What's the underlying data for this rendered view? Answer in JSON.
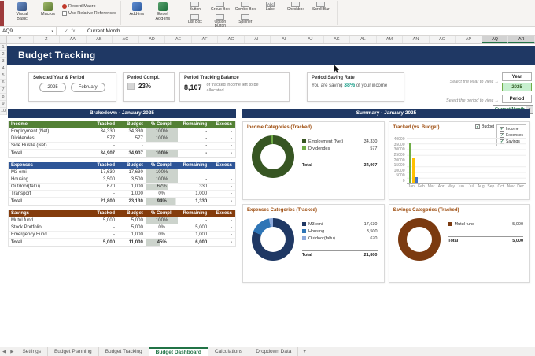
{
  "theme": {
    "navy": "#1F3864",
    "excel_green": "#217346",
    "card_title": "#9C4A0B",
    "teal": "#21A18C",
    "accent_strip": "#9E3B3B",
    "pct_fill_color": "#CCD3CC"
  },
  "ribbon": {
    "visual_basic": "Visual Basic",
    "macros": "Macros",
    "record_macro": "Record Macro",
    "use_relative_references": "Use Relative References",
    "add_ins": "Add-ins",
    "excel_add_ins": "Excel Add-ins",
    "controls": [
      {
        "label": "Button",
        "icon": ""
      },
      {
        "label": "Group Box",
        "icon": ""
      },
      {
        "label": "Combo Box",
        "icon": ""
      },
      {
        "label": "Label",
        "icon": "Abc"
      },
      {
        "label": "Checkbox",
        "icon": ""
      },
      {
        "label": "Scroll Bar",
        "icon": ""
      }
    ],
    "controls2": [
      {
        "label": "List Box",
        "icon": ""
      },
      {
        "label": "Option Button",
        "icon": ""
      },
      {
        "label": "Spinner",
        "icon": ""
      }
    ]
  },
  "formula_bar": {
    "name_box": "AQ9",
    "dropdown_arrow": "▾",
    "check": "✓",
    "fx": "fx",
    "value": "Current Month"
  },
  "grid": {
    "columns": [
      {
        "label": "Y",
        "cls": ""
      },
      {
        "label": "Z",
        "cls": ""
      },
      {
        "label": "AA",
        "cls": ""
      },
      {
        "label": "AB",
        "cls": ""
      },
      {
        "label": "AC",
        "cls": ""
      },
      {
        "label": "AD",
        "cls": ""
      },
      {
        "label": "AE",
        "cls": ""
      },
      {
        "label": "AF",
        "cls": ""
      },
      {
        "label": "AG",
        "cls": ""
      },
      {
        "label": "AH",
        "cls": ""
      },
      {
        "label": "AI",
        "cls": ""
      },
      {
        "label": "AJ",
        "cls": ""
      },
      {
        "label": "AK",
        "cls": ""
      },
      {
        "label": "AL",
        "cls": ""
      },
      {
        "label": "AM",
        "cls": ""
      },
      {
        "label": "AN",
        "cls": ""
      },
      {
        "label": "AO",
        "cls": ""
      },
      {
        "label": "AP",
        "cls": ""
      },
      {
        "label": "AQ",
        "cls": "sel"
      },
      {
        "label": "AR",
        "cls": "sel"
      }
    ],
    "rows": [
      "1",
      "2",
      "3",
      "4",
      "5",
      "6",
      "7",
      "8",
      "9",
      "10"
    ]
  },
  "page": {
    "title": "Budget Tracking"
  },
  "controls_panel": {
    "year_period": {
      "label": "Selected Year & Period",
      "year": "2025",
      "period": "February"
    },
    "period_compl": {
      "label": "Period Compl.",
      "value": "23%"
    },
    "tracking_balance": {
      "label": "Period Tracking Balance",
      "amount": "8,107",
      "desc": "of tracked income left to be allocated"
    },
    "saving_rate": {
      "label": "Period Saving Rate",
      "prefix": "You are saving",
      "pct": "38%",
      "suffix": "of your income"
    },
    "select_year_hint": "Select the year to view →",
    "select_period_hint": "Select the period to view →",
    "year_box": {
      "label": "Year",
      "value": "2025"
    },
    "period_box": {
      "label": "Period",
      "value": "Current Month",
      "arrow": "▾"
    }
  },
  "breakdown": {
    "title": "Brakedown - January 2025",
    "col_headers": [
      "Tracked",
      "Budget",
      "% Compl.",
      "Remaining",
      "Excess"
    ],
    "sections": [
      {
        "name": "Income",
        "color": "#538135",
        "rows": [
          {
            "name": "Employment (Net)",
            "tracked": "34,330",
            "budget": "34,330",
            "pct": "100%",
            "pct_fill": 100,
            "remaining": "-",
            "excess": "-",
            "cls": ""
          },
          {
            "name": "Dividendes",
            "tracked": "577",
            "budget": "577",
            "pct": "100%",
            "pct_fill": 100,
            "remaining": "-",
            "excess": "-",
            "cls": ""
          },
          {
            "name": "Side Hustle (Net)",
            "tracked": "-",
            "budget": "-",
            "pct": "",
            "pct_fill": null,
            "remaining": "-",
            "excess": "-",
            "cls": ""
          },
          {
            "name": "Total",
            "tracked": "34,907",
            "budget": "34,907",
            "pct": "100%",
            "pct_fill": 100,
            "remaining": "-",
            "excess": "-",
            "cls": "total"
          }
        ]
      },
      {
        "name": "Expenses",
        "color": "#2E5597",
        "rows": [
          {
            "name": "M3 emi",
            "tracked": "17,630",
            "budget": "17,630",
            "pct": "100%",
            "pct_fill": 100,
            "remaining": "-",
            "excess": "-",
            "cls": ""
          },
          {
            "name": "Housing",
            "tracked": "3,500",
            "budget": "3,500",
            "pct": "100%",
            "pct_fill": 100,
            "remaining": "-",
            "excess": "-",
            "cls": ""
          },
          {
            "name": "Outdoor(faltu)",
            "tracked": "670",
            "budget": "1,000",
            "pct": "67%",
            "pct_fill": 67,
            "remaining": "330",
            "excess": "-",
            "cls": ""
          },
          {
            "name": "Transport",
            "tracked": "-",
            "budget": "1,000",
            "pct": "0%",
            "pct_fill": 0,
            "remaining": "1,000",
            "excess": "-",
            "cls": ""
          },
          {
            "name": "Total",
            "tracked": "21,800",
            "budget": "23,130",
            "pct": "94%",
            "pct_fill": 94,
            "remaining": "1,330",
            "excess": "-",
            "cls": "total"
          }
        ]
      },
      {
        "name": "Savings",
        "color": "#843C0C",
        "rows": [
          {
            "name": "Mutul fund",
            "tracked": "5,000",
            "budget": "5,000",
            "pct": "100%",
            "pct_fill": 100,
            "remaining": "-",
            "excess": "-",
            "cls": ""
          },
          {
            "name": "Stock Portfolio",
            "tracked": "-",
            "budget": "5,000",
            "pct": "0%",
            "pct_fill": 0,
            "remaining": "5,000",
            "excess": "-",
            "cls": ""
          },
          {
            "name": "Emergency Fund",
            "tracked": "-",
            "budget": "1,000",
            "pct": "0%",
            "pct_fill": 0,
            "remaining": "1,000",
            "excess": "-",
            "cls": ""
          },
          {
            "name": "Total",
            "tracked": "5,000",
            "budget": "11,000",
            "pct": "45%",
            "pct_fill": 45,
            "remaining": "6,000",
            "excess": "-",
            "cls": "total"
          }
        ]
      }
    ]
  },
  "summary": {
    "title": "Summary - January 2025",
    "income_card": {
      "title": "Income Categories (Tracked)",
      "legend": [
        {
          "label": "Employment (Net)",
          "value": "34,330",
          "color": "#375623"
        },
        {
          "label": "Dividendes",
          "value": "577",
          "color": "#70AD47"
        }
      ],
      "donut": [
        {
          "name": "Employment (Net)",
          "value": 34330,
          "color": "#375623"
        },
        {
          "name": "Dividendes",
          "value": 577,
          "color": "#70AD47"
        }
      ],
      "total_label": "Total",
      "total": "34,907"
    },
    "bar_card": {
      "title": "Tracked (vs. Budget)",
      "checkboxes": [
        "Budget",
        "Income",
        "Expenses",
        "Savings"
      ],
      "check_glyph": "✓",
      "y_ticks": [
        "40000",
        "35000",
        "30000",
        "25000",
        "20000",
        "15000",
        "10000",
        "5000",
        "0"
      ],
      "months": [
        "Jan",
        "Feb",
        "Mar",
        "Apr",
        "May",
        "Jun",
        "Jul",
        "Aug",
        "Sep",
        "Oct",
        "Nov",
        "Dec"
      ],
      "max": 40000,
      "bars": [
        {
          "name": "Income",
          "value": 34907,
          "color": "#70AD47"
        },
        {
          "name": "Expenses",
          "value": 21800,
          "color": "#FFC000"
        },
        {
          "name": "Savings",
          "value": 5000,
          "color": "#4472C4"
        }
      ]
    },
    "expenses_card": {
      "title": "Expenses Categories (Tracked)",
      "legend": [
        {
          "label": "M3 emi",
          "value": "17,630",
          "color": "#1F3864"
        },
        {
          "label": "Housing",
          "value": "3,500",
          "color": "#2E75B6"
        },
        {
          "label": "Outdoor(faltu)",
          "value": "670",
          "color": "#8EAADB"
        }
      ],
      "donut": [
        {
          "name": "M3 emi",
          "value": 17630,
          "color": "#1F3864"
        },
        {
          "name": "Housing",
          "value": 3500,
          "color": "#2E75B6"
        },
        {
          "name": "Outdoor(faltu)",
          "value": 670,
          "color": "#8EAADB"
        }
      ],
      "total_label": "Total",
      "total": "21,800"
    },
    "savings_card": {
      "title": "Savings Categories (Tracked)",
      "legend": [
        {
          "label": "Mutul fund",
          "value": "5,000",
          "color": "#7B3A10"
        }
      ],
      "donut": [
        {
          "name": "Mutul fund",
          "value": 5000,
          "color": "#7B3A10"
        }
      ],
      "total_label": "Total",
      "total": "5,000"
    }
  },
  "tabs": {
    "nav_left": "◀",
    "nav_right": "▶",
    "items": [
      {
        "label": "Settings",
        "cls": ""
      },
      {
        "label": "Budget Planning",
        "cls": ""
      },
      {
        "label": "Budget Tracking",
        "cls": ""
      },
      {
        "label": "Budget Dashboard",
        "cls": "active"
      },
      {
        "label": "Calculations",
        "cls": ""
      },
      {
        "label": "Dropdown Data",
        "cls": ""
      }
    ],
    "add": "+"
  }
}
